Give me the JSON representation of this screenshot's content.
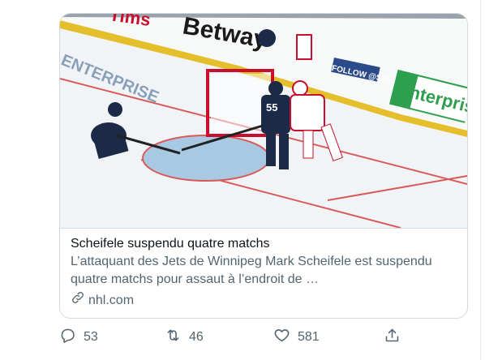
{
  "card": {
    "title": "Scheifele suspendu quatre matchs",
    "description": "L’attaquant des Jets de Winnipeg Mark Scheifele est suspendu quatre matchs pour assaut à l’endroit de …",
    "domain": "nhl.com",
    "media": {
      "board_ads": [
        "Betway",
        "FOLLOW @SEIZZY",
        "Enterprise"
      ],
      "jersey_numbers": [
        "55"
      ]
    }
  },
  "actions": {
    "reply_count": "53",
    "retweet_count": "46",
    "like_count": "581"
  },
  "colors": {
    "text_primary": "#0f1419",
    "text_secondary": "#536471",
    "border": "#cfd9de",
    "enterprise_green": "#2e9e4f",
    "jets_navy": "#1b2a47",
    "habs_red": "#c8102e"
  },
  "icons": [
    "link-icon",
    "reply-icon",
    "retweet-icon",
    "like-icon",
    "share-icon"
  ]
}
